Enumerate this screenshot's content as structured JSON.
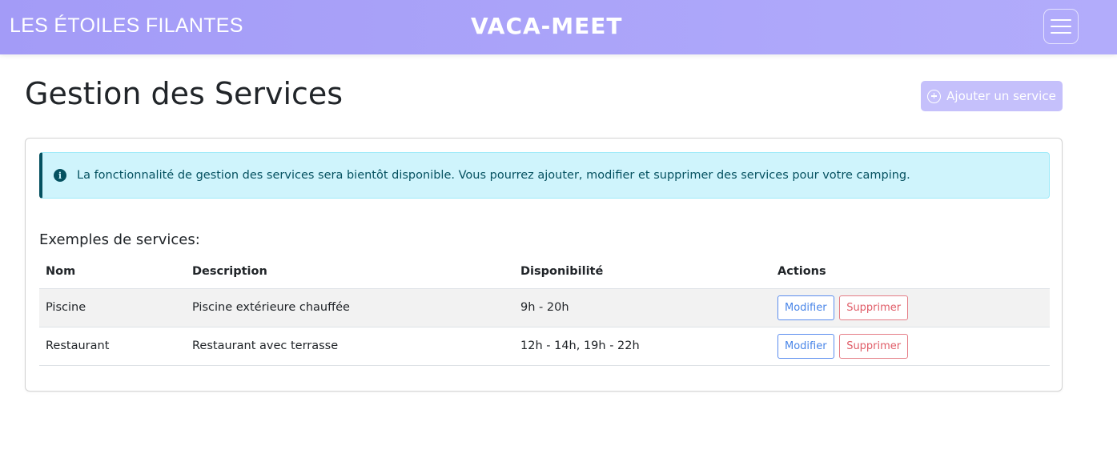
{
  "navbar": {
    "brand": "LES ÉTOILES FILANTES",
    "app_title": "VACA-MEET",
    "menu_icon": "hamburger-icon"
  },
  "page": {
    "title": "Gestion des Services",
    "add_button_label": "Ajouter un service",
    "add_button_icon": "plus-circle-icon"
  },
  "alert": {
    "icon": "info-icon",
    "text": "La fonctionnalité de gestion des services sera bientôt disponible. Vous pourrez ajouter, modifier et supprimer des services pour votre camping."
  },
  "examples": {
    "title": "Exemples de services:",
    "columns": [
      "Nom",
      "Description",
      "Disponibilité",
      "Actions"
    ],
    "rows": [
      {
        "name": "Piscine",
        "description": "Piscine extérieure chauffée",
        "availability": "9h - 20h",
        "edit_label": "Modifier",
        "delete_label": "Supprimer"
      },
      {
        "name": "Restaurant",
        "description": "Restaurant avec terrasse",
        "availability": "12h - 14h, 19h - 22h",
        "edit_label": "Modifier",
        "delete_label": "Supprimer"
      }
    ]
  },
  "colors": {
    "navbar_start": "#a39bf7",
    "navbar_end": "#b2acfb",
    "add_button": "#c5c0fb",
    "alert_bg": "#cff4fc",
    "alert_text": "#055160",
    "edit_outline": "#5b8def",
    "delete_outline": "#e57d86"
  }
}
